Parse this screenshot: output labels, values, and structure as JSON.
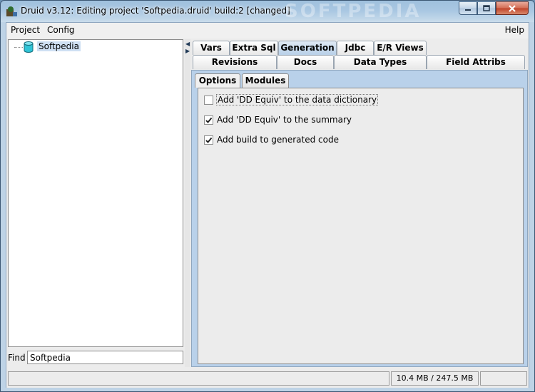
{
  "window": {
    "title": "Druid v3.12: Editing project 'Softpedia.druid' build:2 [changed]",
    "watermark": "SOFTPEDIA"
  },
  "menubar": {
    "project": "Project",
    "config": "Config",
    "help": "Help"
  },
  "tree": {
    "root_label": "Softpedia"
  },
  "find": {
    "label": "Find",
    "value": "Softpedia"
  },
  "tabs": {
    "row1": [
      "Vars",
      "Extra Sql",
      "Generation",
      "Jdbc",
      "E/R Views"
    ],
    "row2": [
      "Revisions",
      "Docs",
      "Data Types",
      "Field Attribs"
    ],
    "active": "Generation"
  },
  "subtabs": {
    "items": [
      "Options",
      "Modules"
    ],
    "active": "Options"
  },
  "options": [
    {
      "label": "Add 'DD Equiv' to the data dictionary",
      "checked": false
    },
    {
      "label": "Add 'DD Equiv' to the summary",
      "checked": true
    },
    {
      "label": "Add build to generated code",
      "checked": true
    }
  ],
  "status": {
    "message": "",
    "memory": "10.4 MB / 247.5 MB",
    "extra": ""
  },
  "colors": {
    "title_gradient": "#a9c7e2",
    "active_tab": "#b8d0e8",
    "pane_bg": "#b9d1ea",
    "selection": "#cfe0f3"
  },
  "icons": {
    "app": "druid-app-icon",
    "tree_node": "database-icon",
    "check": "check-mark-icon"
  }
}
